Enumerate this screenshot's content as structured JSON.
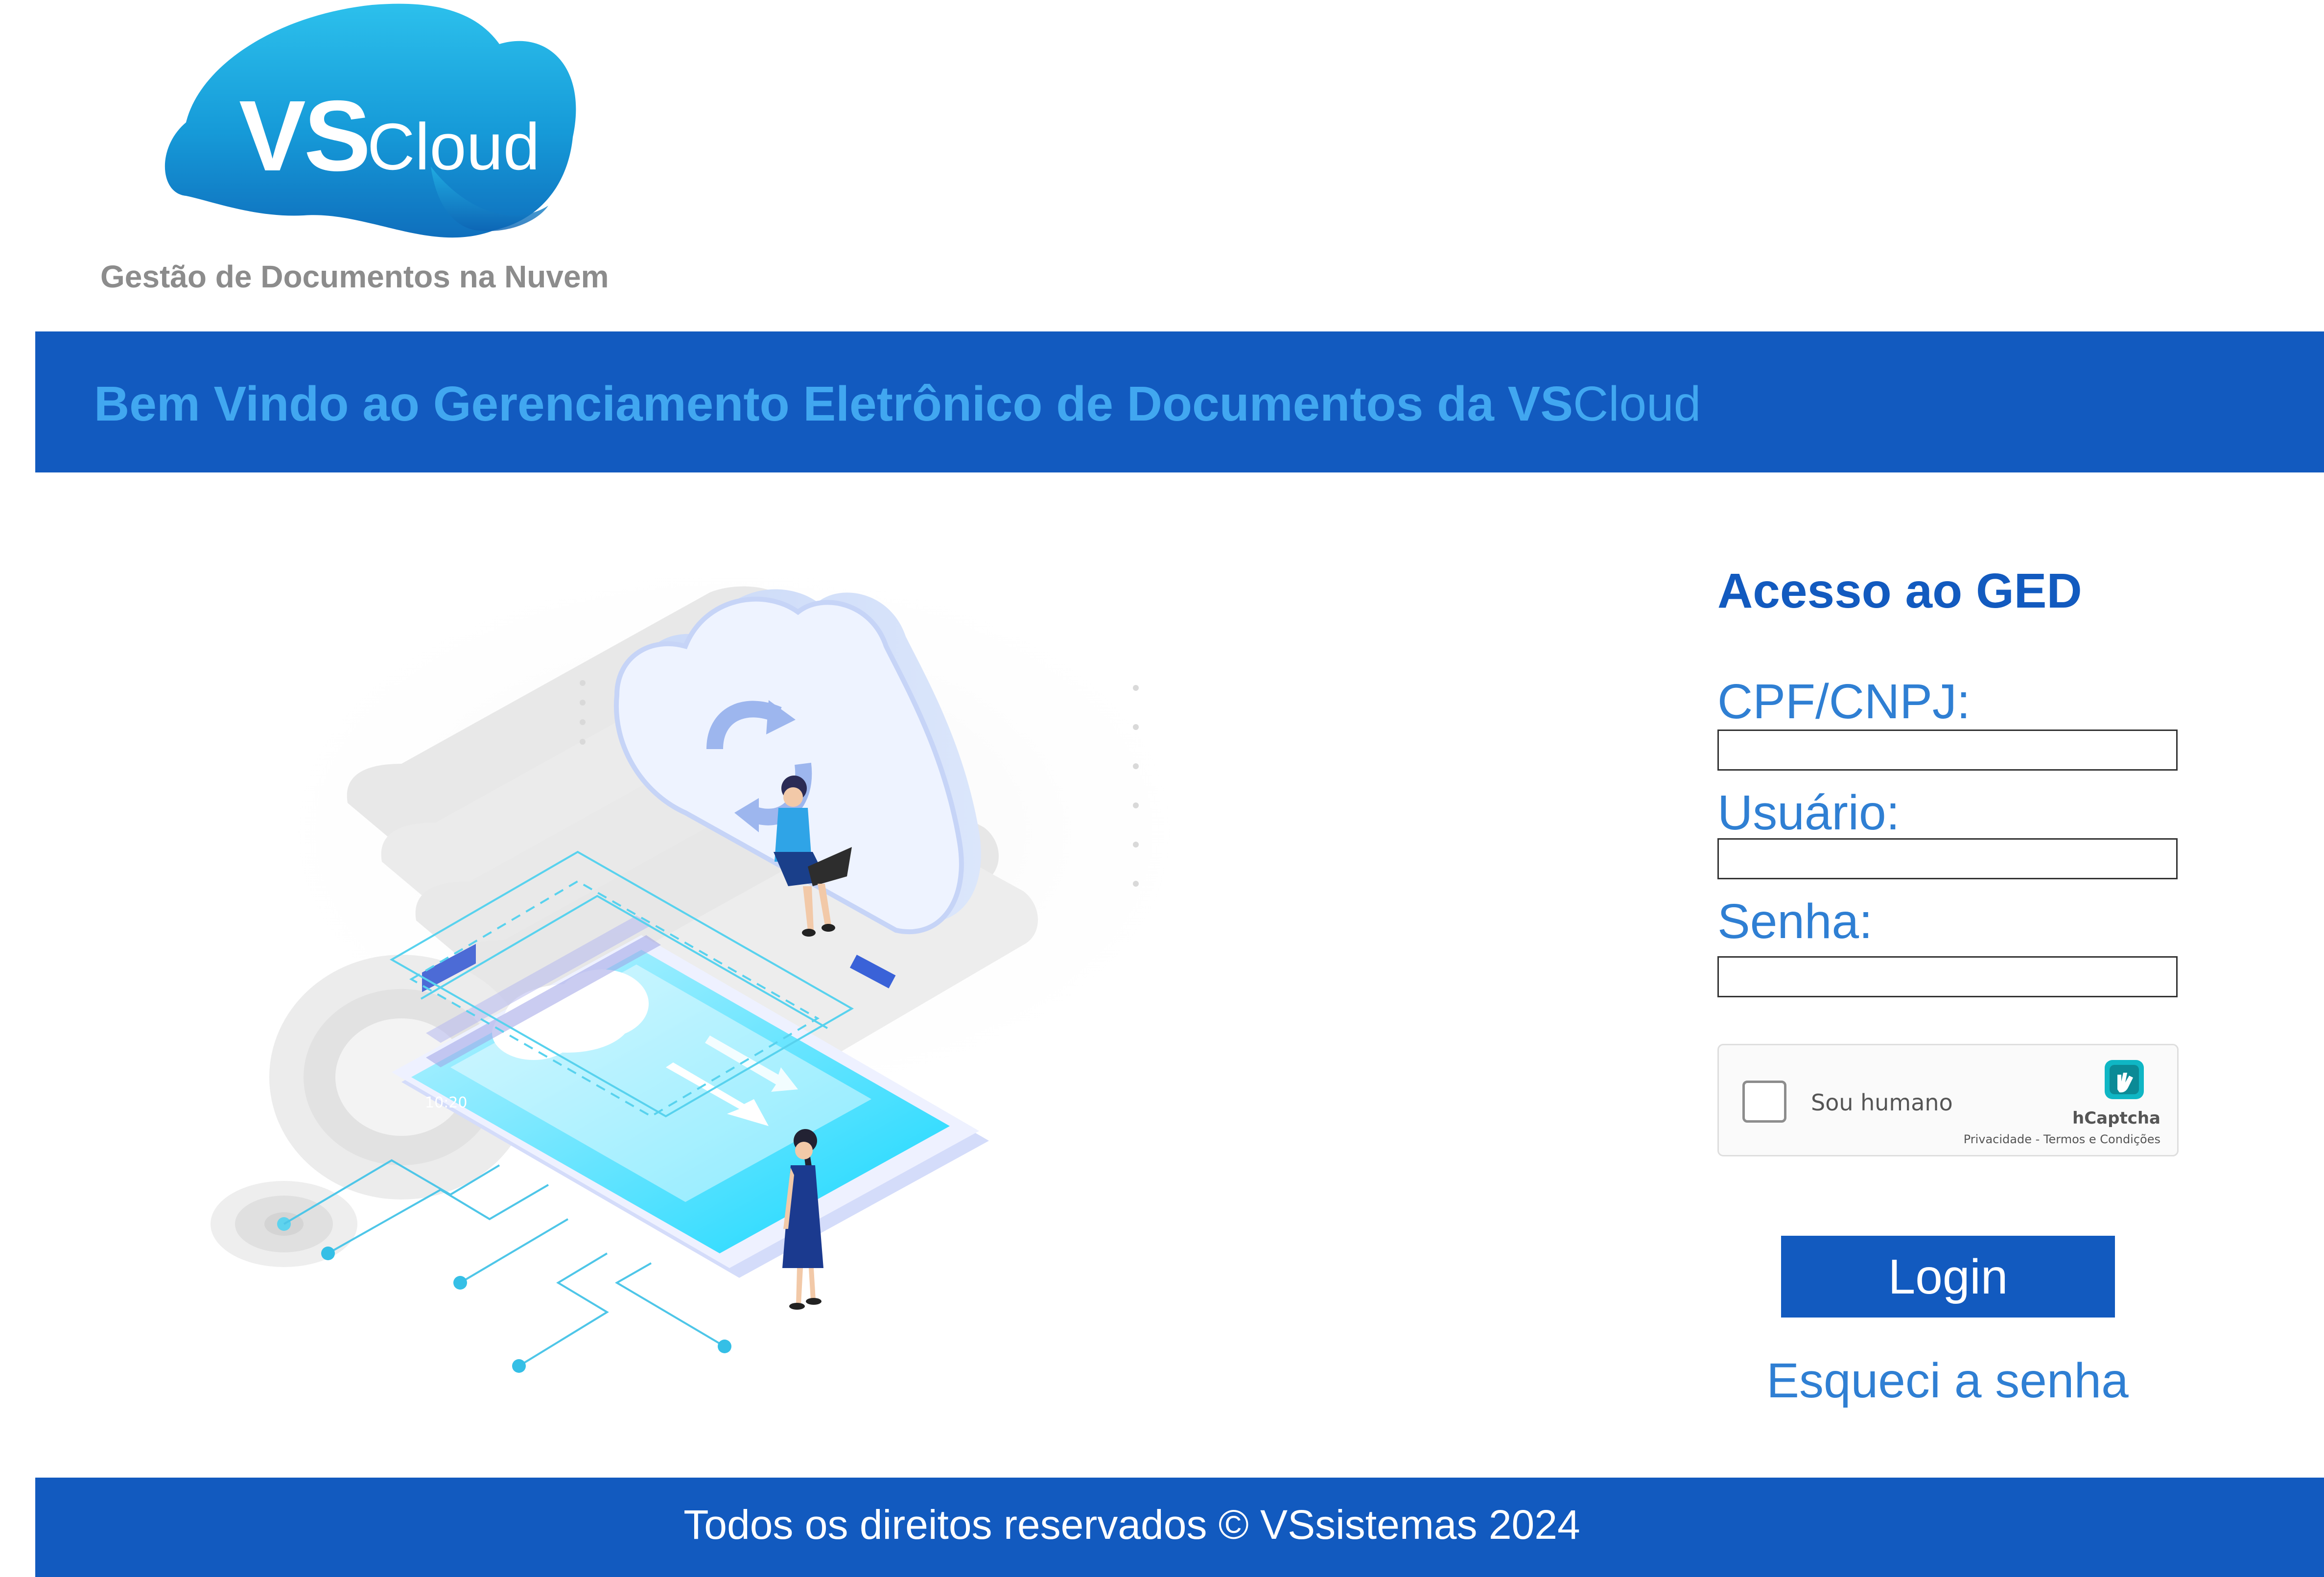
{
  "logo": {
    "brand_bold": "VS",
    "brand_light": "Cloud",
    "tagline": "Gestão de Documentos na Nuvem"
  },
  "header": {
    "welcome_bold": "Bem Vindo ao Gerenciamento Eletrônico de Documentos da VS",
    "welcome_light": "Cloud"
  },
  "illustration": {
    "phone_time": "10:20"
  },
  "login": {
    "title": "Acesso ao GED",
    "cpf_label": "CPF/CNPJ:",
    "cpf_value": "",
    "user_label": "Usuário:",
    "user_value": "",
    "password_label": "Senha:",
    "password_value": "",
    "captcha": {
      "checkbox_label": "Sou humano",
      "brand": "hCaptcha",
      "links": "Privacidade - Termos e Condições",
      "checked": false
    },
    "login_button": "Login",
    "forgot_link": "Esqueci a senha"
  },
  "footer": {
    "copyright": "Todos os direitos reservados © VSsistemas 2024"
  },
  "colors": {
    "brand_blue": "#125abf",
    "light_blue_text": "#41a7f0",
    "label_blue": "#2f7fd3",
    "logo_cyan": "#1aa8e0",
    "tagline_gray": "#8c8c8c"
  },
  "icons": {
    "captcha_logo": "hcaptcha-hand-icon",
    "cloud_sync": "cloud-sync-icon"
  }
}
